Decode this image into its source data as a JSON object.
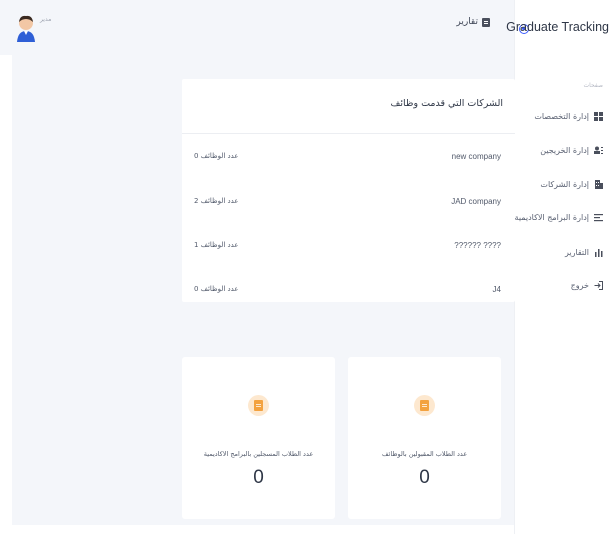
{
  "brand": {
    "title": "Graduate Tracking"
  },
  "sidebar": {
    "section_label": "صفحات",
    "items": [
      {
        "label": "إدارة التخصصات",
        "icon": "grid-icon"
      },
      {
        "label": "إدارة الخريجين",
        "icon": "users-icon"
      },
      {
        "label": "إدارة الشركات",
        "icon": "building-icon"
      },
      {
        "label": "إدارة البرامج الاكاديمية",
        "icon": "list-icon"
      },
      {
        "label": "التقارير",
        "icon": "bar-chart-icon"
      },
      {
        "label": "خروج",
        "icon": "logout-icon"
      }
    ]
  },
  "header": {
    "page_title": "تقارير",
    "user_name": "مدير"
  },
  "companies": {
    "title": "الشركات التي قدمت وظائف",
    "rows": [
      {
        "name": "new company",
        "jobs": "عدد الوظائف 0"
      },
      {
        "name": "JAD company",
        "jobs": "عدد الوظائف 2"
      },
      {
        "name": "?????? ????",
        "jobs": "عدد الوظائف 1"
      },
      {
        "name": "J4",
        "jobs": "عدد الوظائف 0"
      }
    ]
  },
  "stats": [
    {
      "label": "عدد الطلاب المسجلين بالبرامج الاكاديمية",
      "value": "0"
    },
    {
      "label": "عدد الطلاب المقبولين بالوظائف",
      "value": "0"
    }
  ],
  "colors": {
    "accent": "#3b5bfd",
    "stat_icon": "#f3a240",
    "stat_icon_bg": "#fde8cf",
    "background": "#f4f6fa"
  }
}
